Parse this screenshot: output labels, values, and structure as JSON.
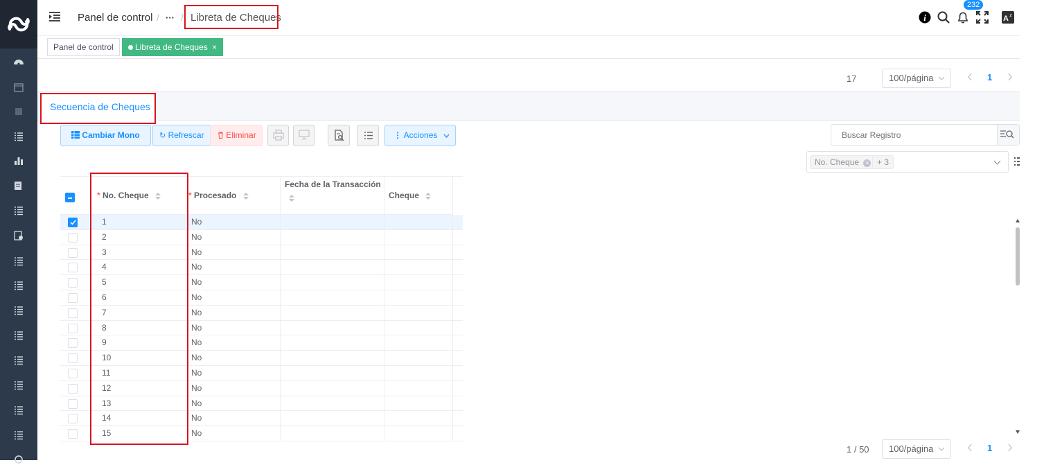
{
  "header": {
    "breadcrumb_home": "Panel de control",
    "breadcrumb_more": "···",
    "breadcrumb_current": "Libreta de Cheques",
    "notification_count": "232"
  },
  "tags": {
    "home": "Panel de control",
    "active": "Libreta de Cheques",
    "close": "×"
  },
  "top_pager": {
    "total": "17",
    "page_size": "100/página",
    "current_page": "1"
  },
  "tab": {
    "label": "Secuencia de Cheques"
  },
  "toolbar": {
    "change_mono": "Cambiar Mono",
    "refresh": "Refrescar",
    "delete": "Eliminar",
    "actions": "Acciones"
  },
  "search": {
    "placeholder": "Buscar Registro"
  },
  "column_filter": {
    "chip": "No. Cheque",
    "more": "+ 3"
  },
  "table": {
    "columns": [
      {
        "label": "No. Cheque",
        "required": true
      },
      {
        "label": "Procesado",
        "required": true
      },
      {
        "label": "Fecha de la Transacción",
        "required": false
      },
      {
        "label": "Cheque",
        "required": false
      }
    ],
    "rows": [
      {
        "no": "1",
        "procesado": "No"
      },
      {
        "no": "2",
        "procesado": "No"
      },
      {
        "no": "3",
        "procesado": "No"
      },
      {
        "no": "4",
        "procesado": "No"
      },
      {
        "no": "5",
        "procesado": "No"
      },
      {
        "no": "6",
        "procesado": "No"
      },
      {
        "no": "7",
        "procesado": "No"
      },
      {
        "no": "8",
        "procesado": "No"
      },
      {
        "no": "9",
        "procesado": "No"
      },
      {
        "no": "10",
        "procesado": "No"
      },
      {
        "no": "11",
        "procesado": "No"
      },
      {
        "no": "12",
        "procesado": "No"
      },
      {
        "no": "13",
        "procesado": "No"
      },
      {
        "no": "14",
        "procesado": "No"
      },
      {
        "no": "15",
        "procesado": "No"
      }
    ]
  },
  "bottom_pager": {
    "range": "1 / 50",
    "page_size": "100/página",
    "current_page": "1"
  },
  "colors": {
    "sidebar": "#2d3a4b",
    "accent": "#1890ff",
    "tag_active": "#42b983",
    "highlight": "#d9131d"
  }
}
